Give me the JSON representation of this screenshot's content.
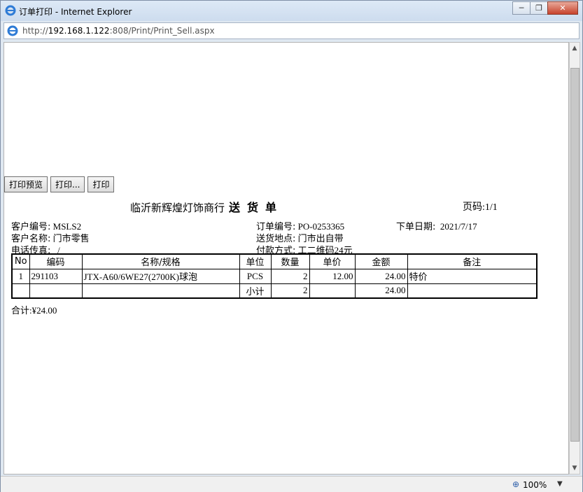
{
  "window": {
    "title": "订单打印 - Internet Explorer",
    "min": "─",
    "restore": "❐",
    "close": "✕"
  },
  "address": {
    "prefix": "http://",
    "host": "192.168.1.122",
    "path": ":808/Print/Print_Sell.aspx"
  },
  "buttons": {
    "preview": "打印预览",
    "print_dialog": "打印...",
    "print": "打印"
  },
  "doc": {
    "company": "临沂新辉煌灯饰商行",
    "doc_type": "送 货 单",
    "page": "页码:1/1",
    "customer_no_label": "客户编号:",
    "customer_no": "MSLS2",
    "customer_name_label": "客户名称:",
    "customer_name": "门市零售",
    "phone_label": "电话传真:",
    "phone": "/",
    "order_no_label": "订单编号:",
    "order_no": "PO-0253365",
    "delivery_label": "送货地点:",
    "delivery": "门市出自带",
    "payment_label": "付款方式:",
    "payment": "工二维码24元",
    "order_date_label": "下单日期:",
    "order_date": "2021/7/17",
    "total": "合计:¥24.00"
  },
  "table": {
    "headers": [
      "No",
      "编码",
      "名称/规格",
      "单位",
      "数量",
      "单价",
      "金额",
      "备注"
    ],
    "rows": [
      [
        "1",
        "291103",
        "JTX-A60/6WE27(2700K)球泡",
        "PCS",
        "2",
        "12.00",
        "24.00",
        "特价"
      ]
    ],
    "subtotal": {
      "label": "小计",
      "qty": "2",
      "amount": "24.00"
    }
  },
  "status": {
    "zoom": "100%"
  }
}
